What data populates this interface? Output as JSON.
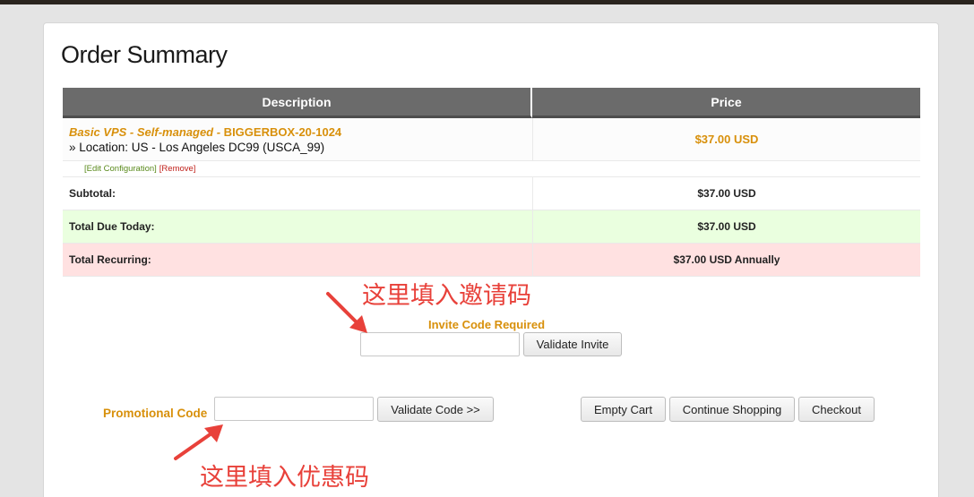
{
  "page": {
    "title": "Order Summary"
  },
  "table": {
    "headers": {
      "description": "Description",
      "price": "Price"
    },
    "product": {
      "name_italic": "Basic VPS - Self-managed -",
      "name_code": " BIGGERBOX-20-1024",
      "location": "» Location: US - Los Angeles DC99 (USCA_99)",
      "price": "$37.00 USD",
      "edit_label": "[Edit Configuration]",
      "remove_label": "[Remove]"
    },
    "subtotal": {
      "label": "Subtotal:",
      "value": "$37.00 USD"
    },
    "total_due": {
      "label": "Total Due Today:",
      "value": "$37.00 USD"
    },
    "total_recurring": {
      "label": "Total Recurring:",
      "value": "$37.00 USD Annually"
    }
  },
  "invite": {
    "label": "Invite Code Required",
    "value": "",
    "button": "Validate Invite",
    "annotation": "这里填入邀请码"
  },
  "promo": {
    "label": "Promotional Code",
    "value": "",
    "button": "Validate Code >>",
    "annotation": "这里填入优惠码"
  },
  "actions": {
    "empty_cart": "Empty Cart",
    "continue_shopping": "Continue Shopping",
    "checkout": "Checkout"
  },
  "colors": {
    "accent": "#d8900b",
    "annotation": "#e8413a",
    "header": "#6b6b6b",
    "due_bg": "#eaffdf",
    "recurring_bg": "#ffe1e1"
  }
}
